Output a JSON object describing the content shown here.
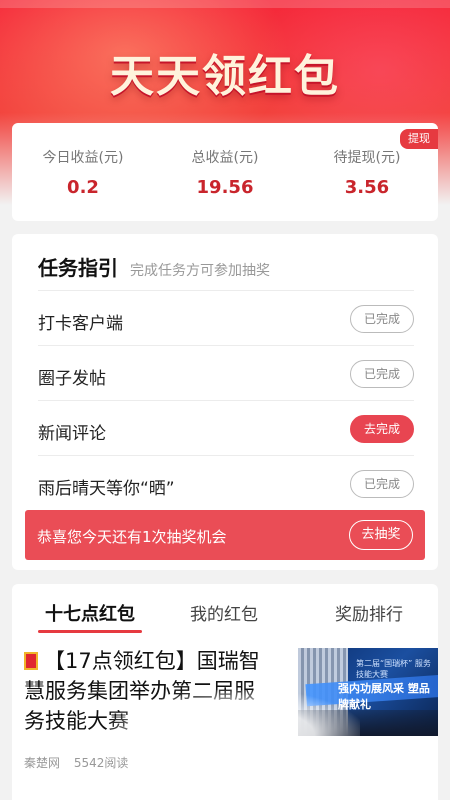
{
  "banner": {
    "title": "天天领红包"
  },
  "earnings": {
    "withdraw_badge": "提现",
    "items": [
      {
        "label": "今日收益(元)",
        "value": "0.2"
      },
      {
        "label": "总收益(元)",
        "value": "19.56"
      },
      {
        "label": "待提现(元)",
        "value": "3.56"
      }
    ]
  },
  "tasks": {
    "title": "任务指引",
    "subtitle": "完成任务方可参加抽奖",
    "items": [
      {
        "name": "打卡客户端",
        "action": "已完成"
      },
      {
        "name": "圈子发帖",
        "action": "已完成"
      },
      {
        "name": "新闻评论",
        "action": "去完成"
      },
      {
        "name": "雨后晴天等你“晒”",
        "action": "已完成"
      }
    ],
    "lottery": {
      "text": "恭喜您今天还有1次抽奖机会",
      "button": "去抽奖"
    }
  },
  "news": {
    "tabs": [
      {
        "label": "十七点红包"
      },
      {
        "label": "我的红包"
      },
      {
        "label": "奖励排行"
      }
    ],
    "article": {
      "title": "【17点领红包】国瑞智慧服务集团举办第二届服务技能大赛",
      "source": "秦楚网",
      "reads": "5542阅读",
      "thumb_line1": "第二届“国瑞杯” 服务技能大赛",
      "thumb_line2": "强内功展风采 塑品牌献礼"
    }
  },
  "colors": {
    "brand_red": "#e63a40",
    "value_red": "#c9252c"
  }
}
